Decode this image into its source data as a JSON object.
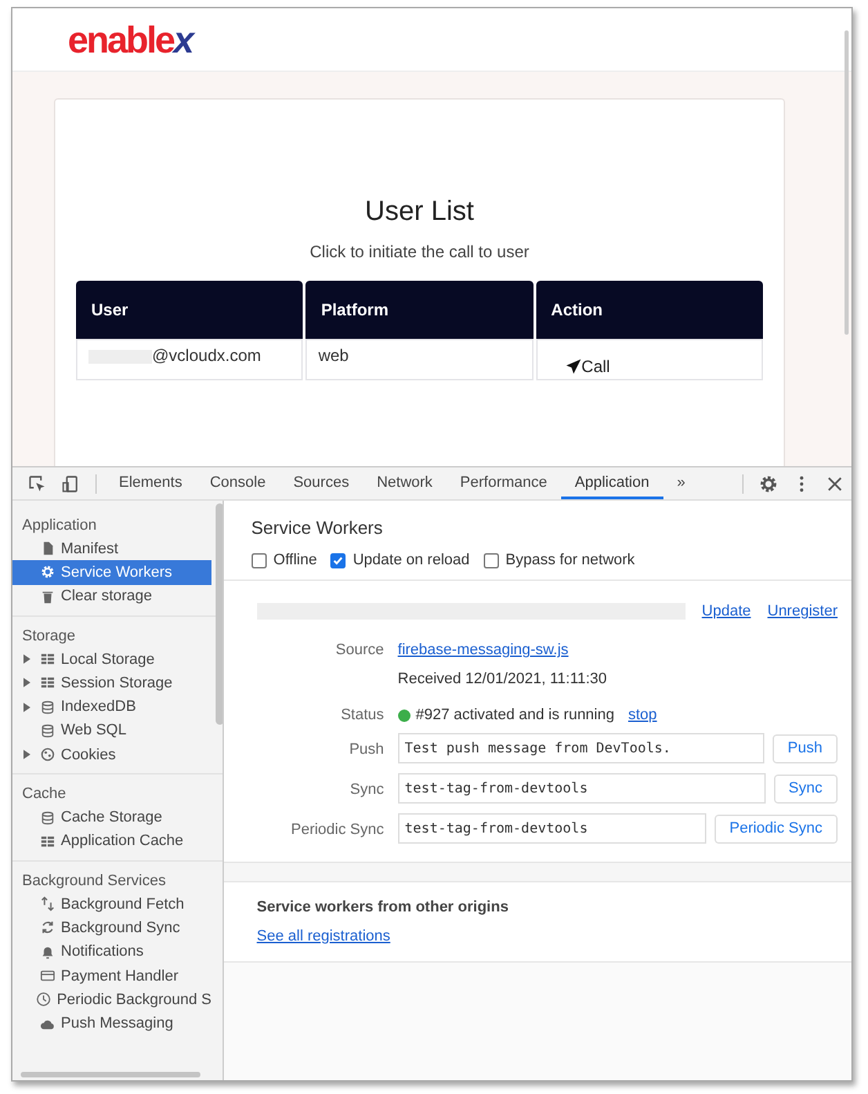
{
  "page": {
    "logo": {
      "text": "enable",
      "accent": "x"
    },
    "title": "User List",
    "subtitle": "Click to initiate the call to user",
    "table": {
      "columns": [
        "User",
        "Platform",
        "Action"
      ],
      "rows": [
        {
          "user": "@vcloudx.com",
          "user_redacted": true,
          "platform": "web",
          "action": "Call"
        }
      ]
    }
  },
  "devtools": {
    "tabs": [
      {
        "label": "Elements",
        "selected": false
      },
      {
        "label": "Console",
        "selected": false
      },
      {
        "label": "Sources",
        "selected": false
      },
      {
        "label": "Network",
        "selected": false
      },
      {
        "label": "Performance",
        "selected": false
      },
      {
        "label": "Application",
        "selected": true
      }
    ],
    "more": "»",
    "sidebar": [
      {
        "title": "Application",
        "items": [
          {
            "label": "Manifest",
            "expandable": false,
            "selected": false
          },
          {
            "label": "Service Workers",
            "expandable": false,
            "selected": true
          },
          {
            "label": "Clear storage",
            "expandable": false,
            "selected": false
          }
        ]
      },
      {
        "title": "Storage",
        "items": [
          {
            "label": "Local Storage",
            "expandable": true,
            "selected": false
          },
          {
            "label": "Session Storage",
            "expandable": true,
            "selected": false
          },
          {
            "label": "IndexedDB",
            "expandable": true,
            "selected": false
          },
          {
            "label": "Web SQL",
            "expandable": false,
            "selected": false
          },
          {
            "label": "Cookies",
            "expandable": true,
            "selected": false
          }
        ]
      },
      {
        "title": "Cache",
        "items": [
          {
            "label": "Cache Storage",
            "expandable": false,
            "selected": false
          },
          {
            "label": "Application Cache",
            "expandable": false,
            "selected": false
          }
        ]
      },
      {
        "title": "Background Services",
        "items": [
          {
            "label": "Background Fetch",
            "expandable": false,
            "selected": false
          },
          {
            "label": "Background Sync",
            "expandable": false,
            "selected": false
          },
          {
            "label": "Notifications",
            "expandable": false,
            "selected": false
          },
          {
            "label": "Payment Handler",
            "expandable": false,
            "selected": false
          },
          {
            "label": "Periodic Background S",
            "expandable": false,
            "selected": false
          },
          {
            "label": "Push Messaging",
            "expandable": false,
            "selected": false
          }
        ]
      }
    ],
    "panel": {
      "title": "Service Workers",
      "options": [
        {
          "label": "Offline",
          "checked": false
        },
        {
          "label": "Update on reload",
          "checked": true
        },
        {
          "label": "Bypass for network",
          "checked": false
        }
      ],
      "worker": {
        "scope_redacted": true,
        "links": [
          "Update",
          "Unregister"
        ],
        "source_label": "Source",
        "source": "firebase-messaging-sw.js",
        "received": "Received 12/01/2021, 11:11:30",
        "status_label": "Status",
        "status": "#927 activated and is running",
        "status_link": "stop",
        "actions": [
          {
            "label": "Push",
            "value": "Test push message from DevTools.",
            "button": "Push"
          },
          {
            "label": "Sync",
            "value": "test-tag-from-devtools",
            "button": "Sync"
          },
          {
            "label": "Periodic Sync",
            "value": "test-tag-from-devtools",
            "button": "Periodic Sync"
          }
        ]
      },
      "other": {
        "title": "Service workers from other origins",
        "link": "See all registrations"
      }
    }
  }
}
